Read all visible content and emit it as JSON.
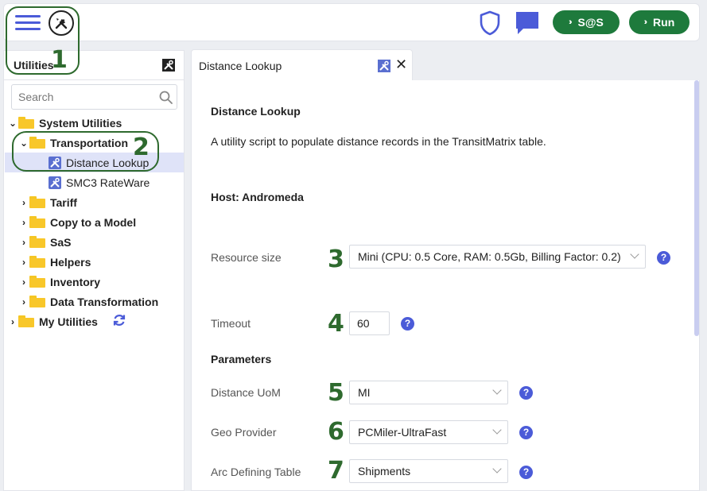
{
  "topbar": {
    "sas_label": "S@S",
    "run_label": "Run"
  },
  "annotations": [
    "1",
    "2",
    "3",
    "4",
    "5",
    "6",
    "7"
  ],
  "left_panel": {
    "title": "Utilities",
    "search_placeholder": "Search",
    "tree": [
      {
        "label": "System Utilities",
        "caret": "⌄"
      },
      {
        "label": "Transportation",
        "caret": "⌄"
      },
      {
        "label": "Distance Lookup"
      },
      {
        "label": "SMC3 RateWare"
      },
      {
        "label": "Tariff",
        "caret": "›"
      },
      {
        "label": "Copy to a Model",
        "caret": "›"
      },
      {
        "label": "SaS",
        "caret": "›"
      },
      {
        "label": "Helpers",
        "caret": "›"
      },
      {
        "label": "Inventory",
        "caret": "›"
      },
      {
        "label": "Data Transformation",
        "caret": "›"
      },
      {
        "label": "My Utilities",
        "caret": "›"
      }
    ]
  },
  "tab": {
    "label": "Distance Lookup"
  },
  "main": {
    "title": "Distance Lookup",
    "description": "A utility script to populate distance records in the TransitMatrix table.",
    "host": "Host: Andromeda",
    "resource_size_label": "Resource size",
    "resource_size_value": "Mini (CPU: 0.5 Core, RAM: 0.5Gb, Billing Factor: 0.2)",
    "timeout_label": "Timeout",
    "timeout_value": "60",
    "parameters_heading": "Parameters",
    "distance_uom_label": "Distance UoM",
    "distance_uom_value": "MI",
    "geo_provider_label": "Geo Provider",
    "geo_provider_value": "PCMiler-UltraFast",
    "arc_table_label": "Arc Defining Table",
    "arc_table_value": "Shipments",
    "help_glyph": "?"
  },
  "colors": {
    "accent": "#4b5bd8",
    "run_green": "#1e7a3c",
    "annotation_green": "#2e6a2e",
    "folder_yellow": "#f8c72a",
    "selected_row": "#dfe3f8"
  }
}
